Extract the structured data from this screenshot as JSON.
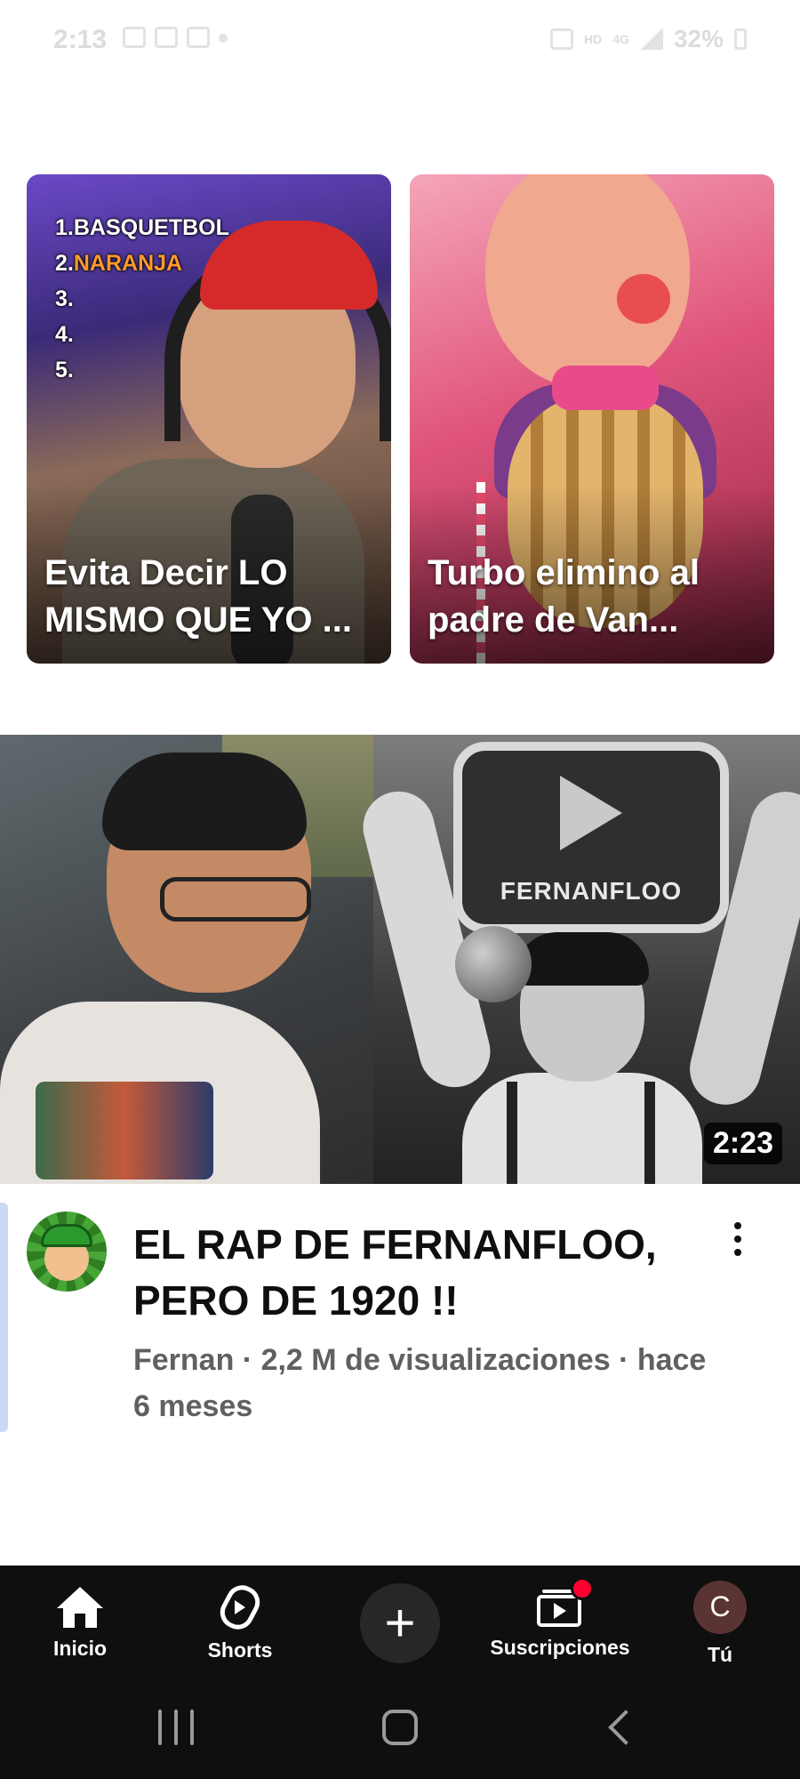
{
  "status_bar": {
    "time": "2:13",
    "network_hd": "HD",
    "network_type": "4G",
    "battery": "32%"
  },
  "shorts": [
    {
      "title": "Evita Decir LO MISMO QUE YO ...",
      "overlay_list": [
        "1.",
        "BASQUETBOL",
        "2.",
        "NARANJA",
        "3.",
        "4.",
        "5."
      ]
    },
    {
      "title": "Turbo elimino al padre de Van..."
    }
  ],
  "video": {
    "thumbnail_text": "FERNANFLOO",
    "duration": "2:23",
    "title": "EL RAP DE FERNANFLOO, PERO DE 1920 !!",
    "meta": "Fernan · 2,2 M de visualizaciones · hace 6 meses"
  },
  "bottom_nav": {
    "home": "Inicio",
    "shorts": "Shorts",
    "create": "+",
    "subscriptions": "Suscripciones",
    "you": "Tú",
    "you_initial": "C"
  },
  "colors": {
    "nav_background": "#0f0f0f",
    "notification_dot": "#ff0033",
    "meta_text": "#606060"
  }
}
